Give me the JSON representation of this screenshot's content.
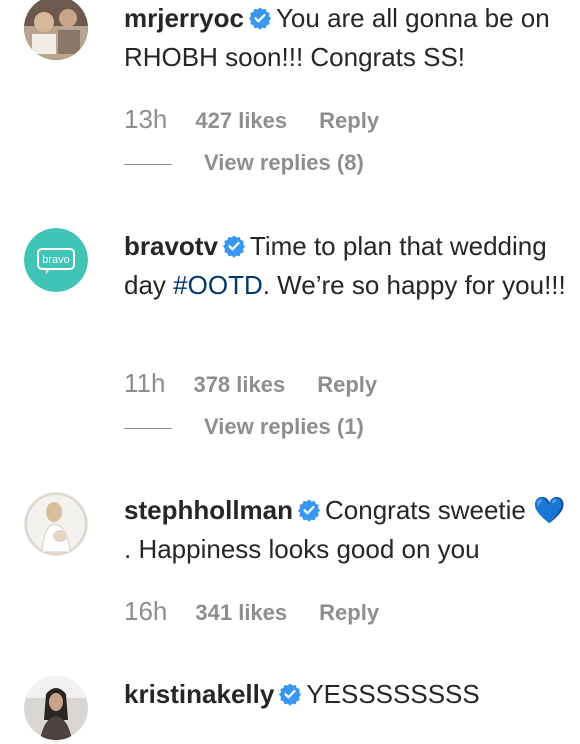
{
  "comments": [
    {
      "username": "mrjerryoc",
      "text": "You are all gonna be on RHOBH soon!!! Congrats SS!",
      "time": "13h",
      "likes": "427 likes",
      "reply_label": "Reply",
      "view_replies": "View replies (8)"
    },
    {
      "username": "bravotv",
      "avatar_label": "bravo",
      "text_before": "Time to plan that wedding day ",
      "hashtag": "#OOTD",
      "text_after": ". We’re so happy for you!!!",
      "time": "11h",
      "likes": "378 likes",
      "reply_label": "Reply",
      "view_replies": "View replies (1)"
    },
    {
      "username": "stephhollman",
      "text_before": "Congrats sweetie ",
      "emoji": "💙",
      "text_after": " . Happiness looks good on you",
      "time": "16h",
      "likes": "341 likes",
      "reply_label": "Reply"
    },
    {
      "username": "kristinakelly",
      "text": "YESSSSSSSS"
    }
  ],
  "colors": {
    "text": "#262626",
    "meta": "#8e8e8e",
    "verified": "#3897f0",
    "hashtag": "#00376b",
    "bravo_teal": "#3fc4b6"
  }
}
